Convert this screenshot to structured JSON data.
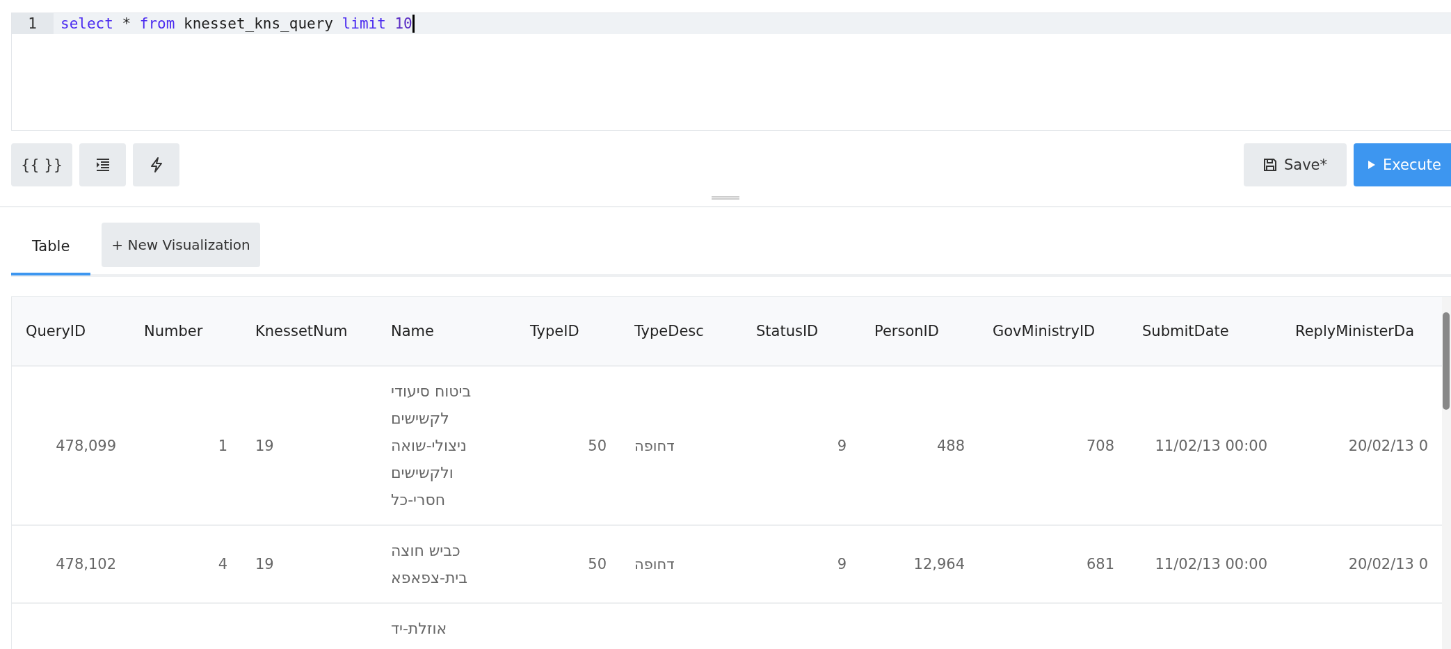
{
  "editor": {
    "lines": [
      {
        "number": "1",
        "active": true,
        "cursor": true,
        "tokens": [
          {
            "text": "select",
            "kind": "keyword"
          },
          {
            "text": " * ",
            "kind": "plain"
          },
          {
            "text": "from",
            "kind": "keyword"
          },
          {
            "text": " knesset_kns_query ",
            "kind": "plain"
          },
          {
            "text": "limit",
            "kind": "keyword"
          },
          {
            "text": " 10",
            "kind": "number"
          }
        ]
      }
    ]
  },
  "toolbar": {
    "template_button": "{{ }}",
    "save_button": "Save*",
    "execute_button": "Execute"
  },
  "tabs": [
    {
      "label": "Table",
      "selected": true
    }
  ],
  "new_visualization_button": "+ New Visualization",
  "table": {
    "columns": [
      {
        "label": "QueryID",
        "numeric": true
      },
      {
        "label": "Number",
        "numeric": true
      },
      {
        "label": "KnessetNum",
        "numeric": false
      },
      {
        "label": "Name",
        "numeric": false
      },
      {
        "label": "TypeID",
        "numeric": true
      },
      {
        "label": "TypeDesc",
        "numeric": false
      },
      {
        "label": "StatusID",
        "numeric": true
      },
      {
        "label": "PersonID",
        "numeric": true
      },
      {
        "label": "GovMinistryID",
        "numeric": true
      },
      {
        "label": "SubmitDate",
        "numeric": true
      },
      {
        "label": "ReplyMinisterDa",
        "numeric": true
      }
    ],
    "rows": [
      {
        "cells": [
          "478,099",
          "1",
          "19",
          "ביטוח סיעודי לקשישים ניצולי-שואה ולקשישים חסרי-כל",
          "50",
          "דחופה",
          "9",
          "488",
          "708",
          "11/02/13 00:00",
          "20/02/13 0"
        ]
      },
      {
        "cells": [
          "478,102",
          "4",
          "19",
          "כביש חוצה בית-צפאפא",
          "50",
          "דחופה",
          "9",
          "12,964",
          "681",
          "11/02/13 00:00",
          "20/02/13 0"
        ]
      },
      {
        "cells": [
          null,
          null,
          null,
          "אוזלת-יד",
          null,
          null,
          null,
          null,
          null,
          null,
          null
        ]
      }
    ]
  }
}
